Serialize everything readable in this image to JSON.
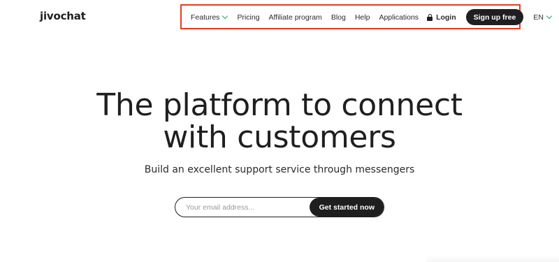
{
  "brand": {
    "logo_text": "jivochat"
  },
  "nav": {
    "features": "Features",
    "pricing": "Pricing",
    "affiliate": "Affiliate program",
    "blog": "Blog",
    "help": "Help",
    "applications": "Applications",
    "login": "Login",
    "signup": "Sign up free",
    "language": "EN"
  },
  "hero": {
    "title_line1": "The platform to connect",
    "title_line2": "with customers",
    "subtitle": "Build an excellent support service through messengers"
  },
  "signup_form": {
    "email_placeholder": "Your email address...",
    "email_value": "",
    "submit_label": "Get started now"
  },
  "colors": {
    "accent_green": "#1ea85b",
    "dark": "#1f1f1f",
    "highlight_red": "#e53b1f"
  }
}
